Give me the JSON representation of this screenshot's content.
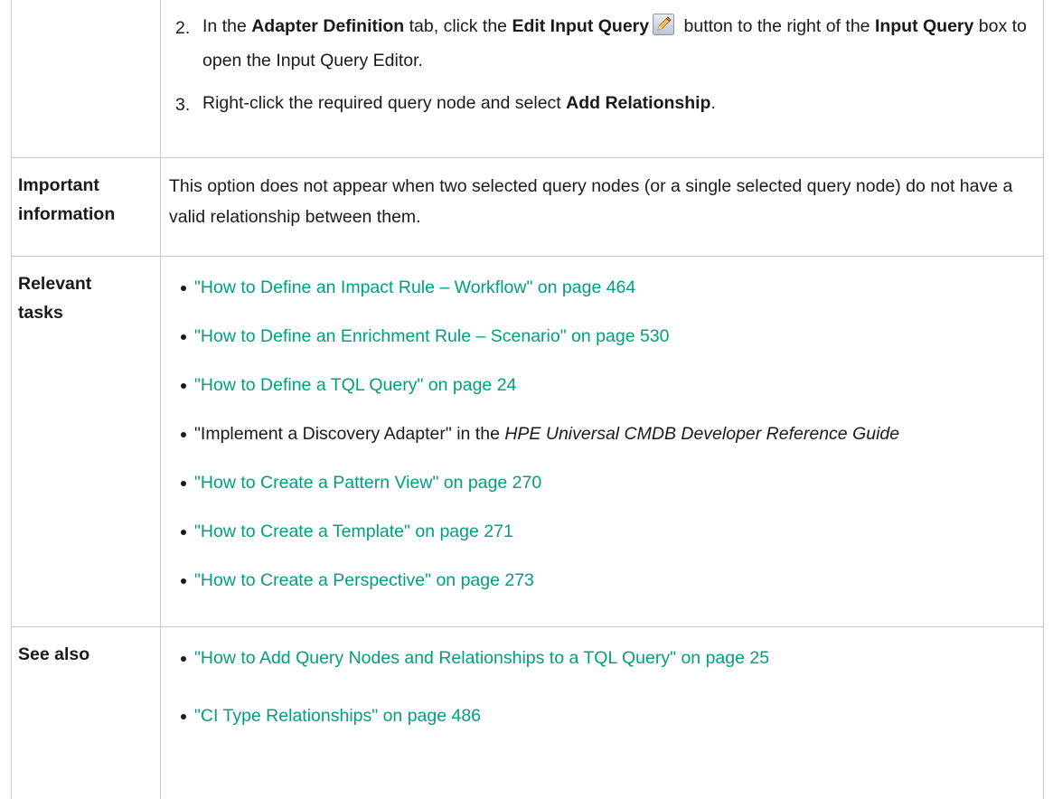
{
  "row1": {
    "step2": {
      "num": "2.",
      "t1": "In the ",
      "b1": "Adapter Definition",
      "t2": " tab, click the ",
      "b2": "Edit Input Query",
      "t3": " button to the right of the ",
      "b3": "Input Query",
      "t4": " box to open the Input Query Editor.",
      "icon": "pencil-edit-icon"
    },
    "step3": {
      "num": "3.",
      "t1": "Right-click the required query node and select ",
      "b1": "Add Relationship",
      "t2": "."
    }
  },
  "row2": {
    "label_line1": "Important",
    "label_line2": "information",
    "text": "This option does not appear when two selected query nodes (or a single selected query node) do not have a valid relationship between them."
  },
  "row3": {
    "label_line1": "Relevant",
    "label_line2": "tasks",
    "items": [
      {
        "link": "\"How to Define an Impact Rule – Workflow\" on page 464"
      },
      {
        "link": "\"How to Define an Enrichment Rule – Scenario\" on page 530"
      },
      {
        "link": "\"How to Define a TQL Query\" on page 24"
      },
      {
        "text": "\"Implement a Discovery Adapter\" in the ",
        "italic": "HPE Universal CMDB Developer Reference Guide"
      },
      {
        "link": "\"How to Create a Pattern View\" on page 270"
      },
      {
        "link": "\"How to Create a Template\" on page 271"
      },
      {
        "link": "\"How to Create a Perspective\" on page 273"
      }
    ]
  },
  "row4": {
    "label": "See also",
    "items": [
      {
        "link": "\"How to Add Query Nodes and Relationships to a TQL Query\" on page 25"
      },
      {
        "link": "\"CI Type Relationships\" on page 486"
      }
    ]
  },
  "colors": {
    "link": "#009e80",
    "border": "#c8c8c8"
  }
}
